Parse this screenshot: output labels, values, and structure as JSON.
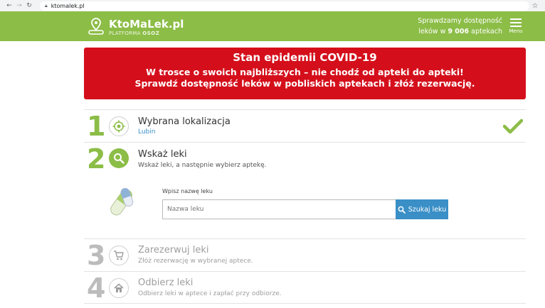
{
  "browser": {
    "url": "ktomalek.pl",
    "back_icon": "arrow-left-icon",
    "forward_icon": "arrow-right-icon",
    "reload_icon": "reload-icon",
    "star_icon": "star-icon"
  },
  "header": {
    "logo_title": "KtoMaLek.pl",
    "logo_sub_prefix": "PLATFORMA",
    "logo_sub_brand": "OSOZ",
    "availability_line1": "Sprawdzamy dostępność",
    "availability_line2_prefix": "leków w",
    "availability_count": "9 006",
    "availability_line2_suffix": "aptekach",
    "menu_label": "Menu",
    "color": "#8cbd47"
  },
  "banner": {
    "title": "Stan epidemii COVID-19",
    "line1": "W trosce o swoich najbliższych – nie chodź od apteki do apteki!",
    "line2": "Sprawdź dostępność leków w pobliskich aptekach i złóż rezerwację.",
    "color": "#d40f1b"
  },
  "steps": [
    {
      "number": "1",
      "title": "Wybrana lokalizacja",
      "desc": "Lubin",
      "icon": "location-target-icon",
      "done": true
    },
    {
      "number": "2",
      "title": "Wskaż leki",
      "desc": "Wskaż leki, a następnie wybierz aptekę.",
      "icon": "search-icon",
      "active": true
    },
    {
      "number": "3",
      "title": "Zarezerwuj leki",
      "desc": "Złóż rezerwację w wybranej aptece.",
      "icon": "cart-icon"
    },
    {
      "number": "4",
      "title": "Odbierz leki",
      "desc": "Odbierz leki w aptece i zapłać przy odbiorze.",
      "icon": "home-icon"
    }
  ],
  "search": {
    "label": "Wpisz nazwę leku",
    "placeholder": "Nazwa leku",
    "value": "",
    "button_label": "Szukaj leku"
  },
  "colors": {
    "accent_green": "#8cbd47",
    "link_blue": "#3a8fc7",
    "muted_gray": "#bcbcbc"
  }
}
